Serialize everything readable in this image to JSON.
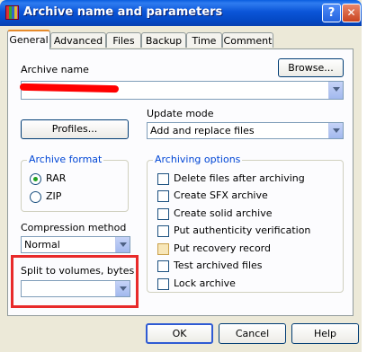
{
  "window": {
    "title": "Archive name and parameters",
    "help_button": "?",
    "close_button": "✕"
  },
  "tabs": [
    "General",
    "Advanced",
    "Files",
    "Backup",
    "Time",
    "Comment"
  ],
  "archive_name": {
    "label": "Archive name",
    "value": "",
    "browse_button": "Browse..."
  },
  "update_mode": {
    "label": "Update mode",
    "selected": "Add and replace files"
  },
  "profiles_button": "Profiles...",
  "archive_format": {
    "title": "Archive format",
    "options": [
      "RAR",
      "ZIP"
    ],
    "selected": "RAR"
  },
  "compression_method": {
    "label": "Compression method",
    "selected": "Normal"
  },
  "split_volumes": {
    "label": "Split to volumes, bytes",
    "value": ""
  },
  "archiving_options": {
    "title": "Archiving options",
    "items": [
      {
        "label": "Delete files after archiving",
        "checked": false
      },
      {
        "label": "Create SFX archive",
        "checked": false
      },
      {
        "label": "Create solid archive",
        "checked": false
      },
      {
        "label": "Put authenticity verification",
        "checked": false
      },
      {
        "label": "Put recovery record",
        "checked": false
      },
      {
        "label": "Test archived files",
        "checked": false
      },
      {
        "label": "Lock archive",
        "checked": false
      }
    ]
  },
  "buttons": {
    "ok": "OK",
    "cancel": "Cancel",
    "help": "Help"
  },
  "colors": {
    "title_bar": "#0a5ddf",
    "highlight_box": "#e82a2a",
    "group_title": "#0046d5"
  }
}
